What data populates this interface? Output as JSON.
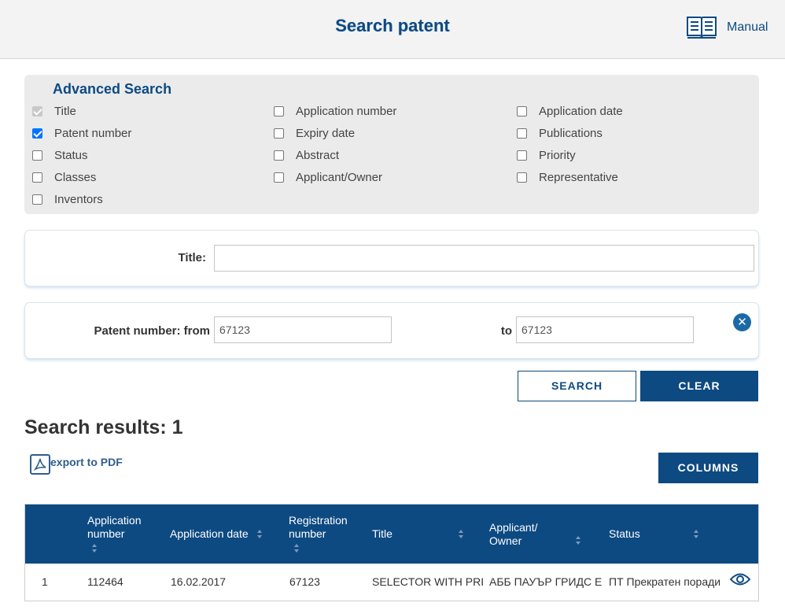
{
  "header": {
    "title": "Search patent",
    "manual_label": "Manual"
  },
  "advanced_search": {
    "title": "Advanced Search",
    "options": [
      {
        "label": "Title",
        "checked": true,
        "disabled": true
      },
      {
        "label": "Patent number",
        "checked": true,
        "disabled": false
      },
      {
        "label": "Status",
        "checked": false,
        "disabled": false
      },
      {
        "label": "Classes",
        "checked": false,
        "disabled": false
      },
      {
        "label": "Inventors",
        "checked": false,
        "disabled": false
      },
      {
        "label": "Application number",
        "checked": false,
        "disabled": false
      },
      {
        "label": "Expiry date",
        "checked": false,
        "disabled": false
      },
      {
        "label": "Abstract",
        "checked": false,
        "disabled": false
      },
      {
        "label": "Applicant/Owner",
        "checked": false,
        "disabled": false
      },
      {
        "label": "Application date",
        "checked": false,
        "disabled": false
      },
      {
        "label": "Publications",
        "checked": false,
        "disabled": false
      },
      {
        "label": "Priority",
        "checked": false,
        "disabled": false
      },
      {
        "label": "Representative",
        "checked": false,
        "disabled": false
      }
    ]
  },
  "title_field": {
    "label": "Title:",
    "value": ""
  },
  "patent_number_field": {
    "label": "Patent number: from",
    "from_value": "67123",
    "to_label": "to",
    "to_value": "67123"
  },
  "actions": {
    "search_label": "SEARCH",
    "clear_label": "CLEAR"
  },
  "results": {
    "title": "Search results: 1",
    "export_label": "export to PDF",
    "columns_label": "COLUMNS",
    "headers": [
      "Application number",
      "Application date",
      "Registration number",
      "Title",
      "Applicant/ Owner",
      "Status"
    ],
    "rows": [
      [
        "1",
        "112464",
        "16.02.2017",
        "67123",
        "SELECTOR WITH PRI",
        "АББ ПАУЪР ГРИДС Е",
        "ПТ Прекратен поради"
      ]
    ]
  },
  "colors": {
    "brand": "#0d4a82",
    "checkbox": "#0075ff",
    "panel_bg": "#ebebeb"
  }
}
